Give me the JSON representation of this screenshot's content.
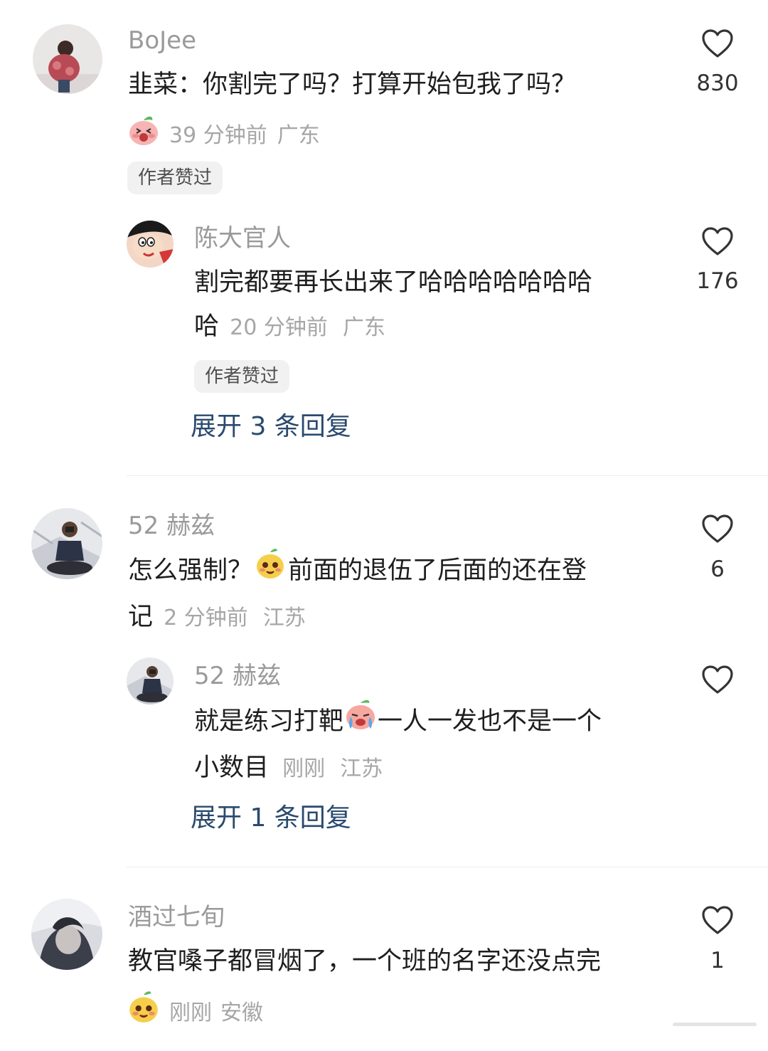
{
  "comments": [
    {
      "username": "BoJee",
      "text": "韭菜：你割完了吗？打算开始包我了吗？",
      "meta_time": "39 分钟前",
      "meta_location": "广东",
      "author_liked_badge": "作者赞过",
      "like_count": "830",
      "reply": {
        "username": "陈大官人",
        "text_line1": "割完都要再长出来了哈哈哈哈哈哈哈",
        "text_line2": "哈",
        "meta_time": "20 分钟前",
        "meta_location": "广东",
        "author_liked_badge": "作者赞过",
        "like_count": "176"
      },
      "expand_replies": "展开 3 条回复"
    },
    {
      "username": "52 赫兹",
      "text_part1": "怎么强制？",
      "text_part2": "前面的退伍了后面的还在登",
      "text_line2": "记",
      "meta_time": "2 分钟前",
      "meta_location": "江苏",
      "like_count": "6",
      "reply": {
        "username": "52 赫兹",
        "text_part1": "就是练习打靶",
        "text_part2": "一人一发也不是一个",
        "text_line2": "小数目",
        "meta_time": "刚刚",
        "meta_location": "江苏"
      },
      "expand_replies": "展开 1 条回复"
    },
    {
      "username": "酒过七旬",
      "text": "教官嗓子都冒烟了，一个班的名字还没点完",
      "meta_time": "刚刚",
      "meta_location": "安徽",
      "like_count": "1"
    }
  ],
  "icons": {
    "like": "heart-outline-icon",
    "emoji_peach": "peach-laugh-emoji",
    "emoji_pear": "pear-smile-emoji",
    "emoji_peach_cry": "peach-cry-emoji"
  },
  "colors": {
    "username": "#9a9a9a",
    "body_text": "#1e1e1e",
    "meta_text": "#a6a6a6",
    "expand_link": "#2a4a6e",
    "badge_bg": "#f1f1f1"
  }
}
